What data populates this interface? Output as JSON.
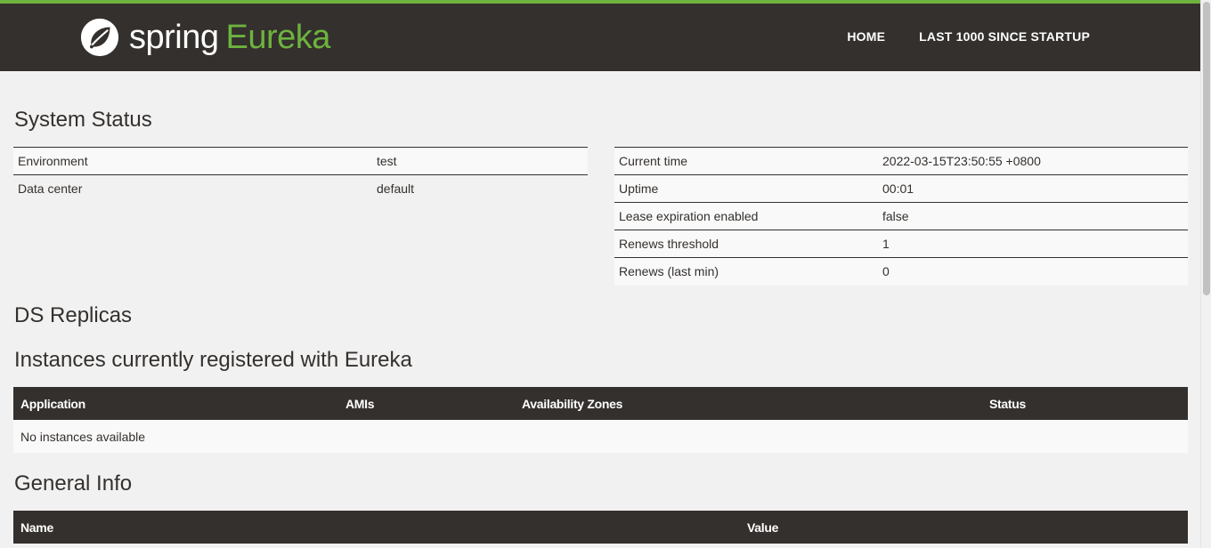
{
  "header": {
    "brand_spring": "spring",
    "brand_eureka": "Eureka",
    "logo_icon": "spring-leaf-icon",
    "nav": [
      "HOME",
      "LAST 1000 SINCE STARTUP"
    ],
    "accent_color": "#6db33f",
    "bar_color": "#34302d"
  },
  "system_status": {
    "title": "System Status",
    "left": [
      {
        "key": "Environment",
        "value": "test"
      },
      {
        "key": "Data center",
        "value": "default"
      }
    ],
    "right": [
      {
        "key": "Current time",
        "value": "2022-03-15T23:50:55 +0800"
      },
      {
        "key": "Uptime",
        "value": "00:01"
      },
      {
        "key": "Lease expiration enabled",
        "value": "false"
      },
      {
        "key": "Renews threshold",
        "value": "1"
      },
      {
        "key": "Renews (last min)",
        "value": "0"
      }
    ]
  },
  "ds_replicas": {
    "title": "DS Replicas"
  },
  "instances": {
    "title": "Instances currently registered with Eureka",
    "columns": [
      "Application",
      "AMIs",
      "Availability Zones",
      "Status"
    ],
    "empty_message": "No instances available"
  },
  "general_info": {
    "title": "General Info",
    "columns": [
      "Name",
      "Value"
    ]
  }
}
